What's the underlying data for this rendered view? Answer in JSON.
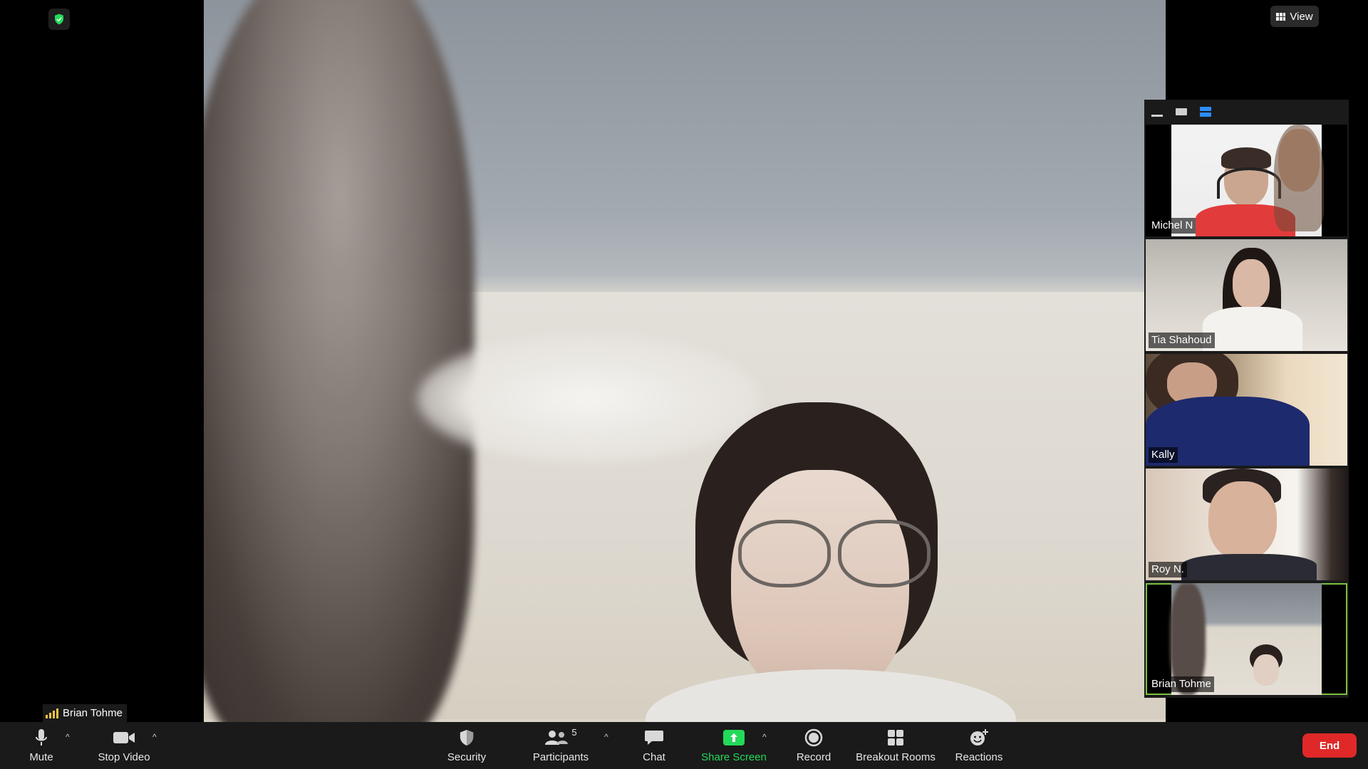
{
  "header": {
    "view_label": "View"
  },
  "main": {
    "speaker_name": "Brian Tohme"
  },
  "gallery": {
    "tiles": [
      {
        "name": "Michel N",
        "active": false
      },
      {
        "name": "Tia Shahoud",
        "active": false
      },
      {
        "name": "Kally",
        "active": false
      },
      {
        "name": "Roy N.",
        "active": false
      },
      {
        "name": "Brian Tohme",
        "active": true
      }
    ]
  },
  "toolbar": {
    "mute": "Mute",
    "stop_video": "Stop Video",
    "security": "Security",
    "participants": "Participants",
    "participants_count": "5",
    "chat": "Chat",
    "share_screen": "Share Screen",
    "record": "Record",
    "breakout_rooms": "Breakout Rooms",
    "reactions": "Reactions",
    "end": "End"
  },
  "colors": {
    "toolbar_bg": "#1a1a1a",
    "share_green": "#23d959",
    "end_red": "#e02828",
    "active_speaker_border": "#7bc043",
    "security_shield": "#23d959",
    "layout_active_blue": "#2d8cff"
  }
}
